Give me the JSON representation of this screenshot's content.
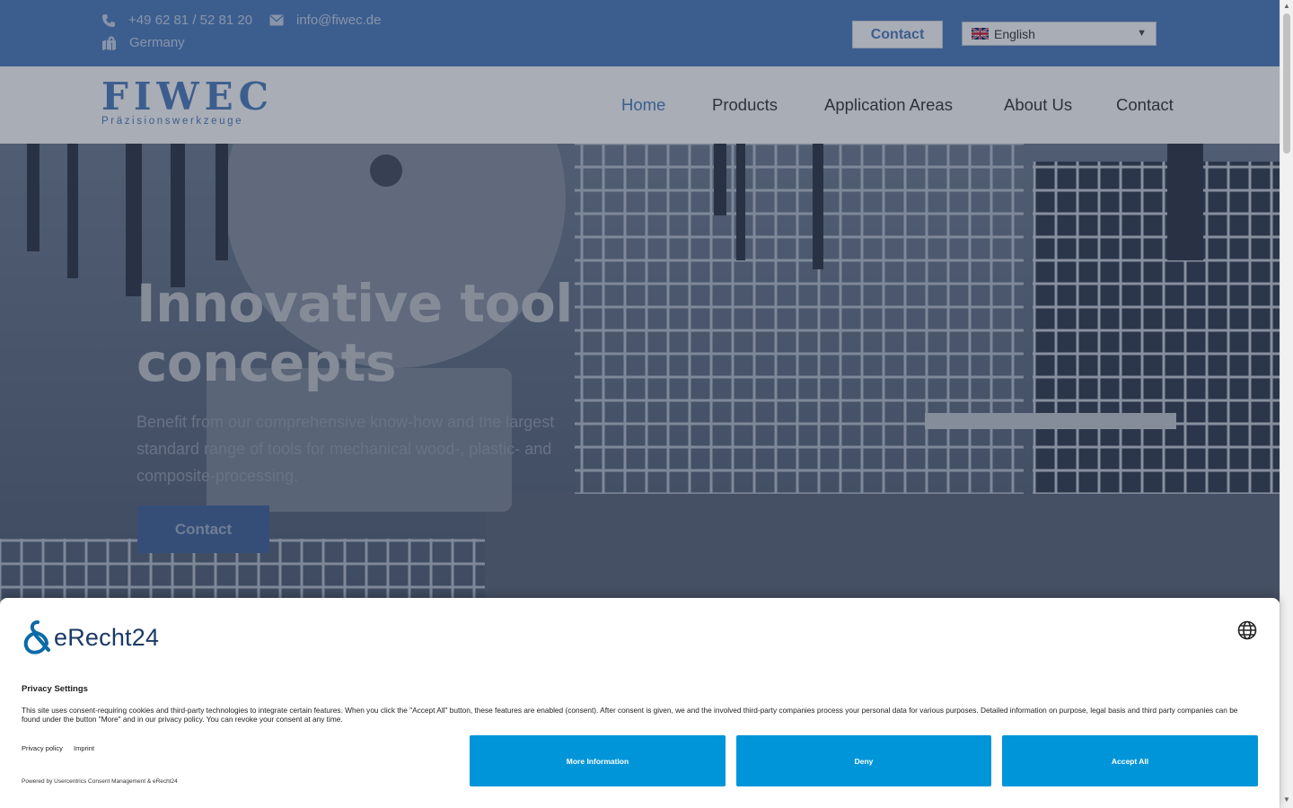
{
  "topbar": {
    "phone": "+49 62 81 / 52 81 20",
    "email": "info@fiwec.de",
    "country": "Germany",
    "contact_button": "Contact",
    "language": "English"
  },
  "nav": {
    "logo_title": "FIWEC",
    "logo_subtitle": "Präzisionswerkzeuge",
    "items": [
      "Home",
      "Products",
      "Application Areas",
      "About Us",
      "Contact"
    ],
    "active": "Home"
  },
  "hero": {
    "title": "Innovative tool concepts",
    "text": "Benefit from our comprehensive know-how and the largest standard range of tools for mechanical wood-, plastic- and composite-processing.",
    "button": "Contact"
  },
  "consent": {
    "brand": "eRecht24",
    "heading": "Privacy Settings",
    "text": "This site uses consent-requiring cookies and third-party technologies to integrate certain features. When you click the \"Accept All\" button, these features are enabled (consent). After consent is given, we and the involved third-party companies process your personal data for various purposes. Detailed information on purpose, legal basis and third party companies can be found under the button \"More\" and in our privacy policy. You can revoke your consent at any time.",
    "links": [
      "Privacy policy",
      "Imprint"
    ],
    "powered_by": "Powered by Usercentrics Consent Management & eRecht24",
    "buttons": [
      "More Information",
      "Deny",
      "Accept All"
    ]
  },
  "colors": {
    "brand_blue": "#4a7cc0",
    "consent_blue": "#0095d9"
  }
}
